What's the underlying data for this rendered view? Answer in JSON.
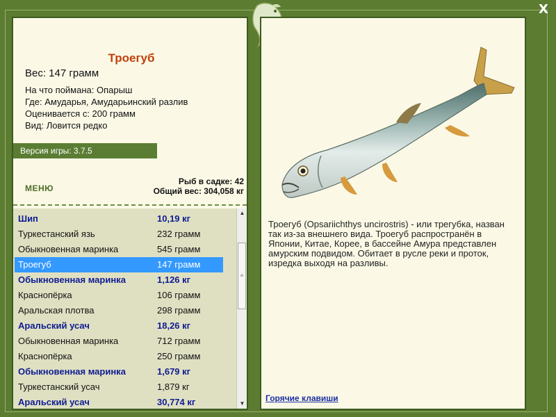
{
  "window": {
    "close_label": "X"
  },
  "fish": {
    "title": "Троегуб",
    "weight": "Вес: 147 грамм",
    "bait": "На что поймана: Опарыш",
    "location": "Где: Амударья, Амударьинский разлив",
    "valued_from": "Оценивается с: 200 грамм",
    "rarity": "Вид: Ловится редко"
  },
  "version": "Версия игры: 3.7.5",
  "menu_label": "МЕНЮ",
  "stats": {
    "fish_in_cage": "Рыб в садке: 42",
    "total_weight": "Общий вес: 304,058 кг"
  },
  "catch_list": [
    {
      "name": "Шип",
      "weight": "10,19 кг",
      "style": "rare"
    },
    {
      "name": "Туркестанский язь",
      "weight": "232 грамм",
      "style": "common"
    },
    {
      "name": "Обыкновенная маринка",
      "weight": "545 грамм",
      "style": "common"
    },
    {
      "name": "Троегуб",
      "weight": "147 грамм",
      "style": "selected"
    },
    {
      "name": "Обыкновенная маринка",
      "weight": "1,126 кг",
      "style": "rare"
    },
    {
      "name": "Краснопёрка",
      "weight": "106 грамм",
      "style": "common"
    },
    {
      "name": "Аральская плотва",
      "weight": "298 грамм",
      "style": "common"
    },
    {
      "name": "Аральский усач",
      "weight": "18,26 кг",
      "style": "rare"
    },
    {
      "name": "Обыкновенная маринка",
      "weight": "712 грамм",
      "style": "common"
    },
    {
      "name": "Краснопёрка",
      "weight": "250 грамм",
      "style": "common"
    },
    {
      "name": "Обыкновенная маринка",
      "weight": "1,679 кг",
      "style": "rare"
    },
    {
      "name": "Туркестанский усач",
      "weight": "1,879 кг",
      "style": "common"
    },
    {
      "name": "Аральский усач",
      "weight": "30,774 кг",
      "style": "rare"
    }
  ],
  "description": "Троегуб (Opsariichthys uncirostris) - или трегубка, назван так из-за внешнего вида. Троегуб распространён в Японии, Китае, Корее, в бассейне Амура представлен амурским подвидом. Обитает в русле реки и проток, изредка выходя на разливы.",
  "hotkeys_label": "Горячие клавиши",
  "colors": {
    "frame_green": "#5b7c31",
    "panel_bg": "#fbf9e6",
    "title_orange": "#c0400b",
    "rare_blue": "#0f1c93",
    "selection_blue": "#3399ff",
    "list_bg": "#dfe0c2"
  },
  "icons": [
    "fish-emblem-icon",
    "close-icon",
    "scroll-up-arrow-icon",
    "scroll-down-arrow-icon",
    "scroll-grip-icon"
  ]
}
